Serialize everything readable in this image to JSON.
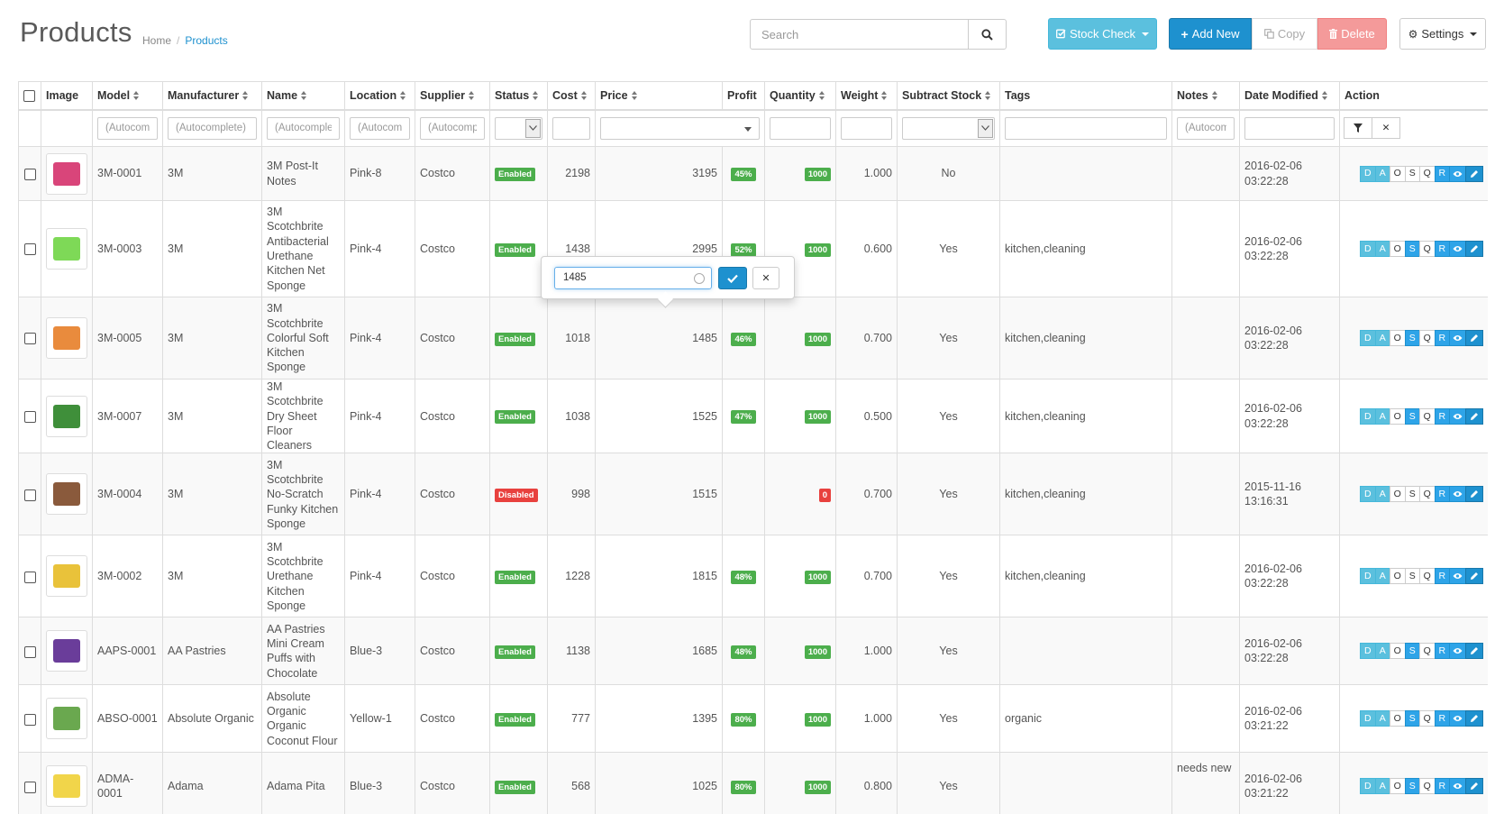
{
  "header": {
    "title": "Products",
    "breadcrumb": [
      "Home",
      "Products"
    ],
    "search_placeholder": "Search",
    "buttons": {
      "stock_check": "Stock Check",
      "add_new": "Add New",
      "copy": "Copy",
      "delete": "Delete",
      "settings": "Settings"
    }
  },
  "colors": {
    "primary": "#1e91cf",
    "info": "#5bc0de",
    "danger": "#f49a9a",
    "enabled": "#4cae4c",
    "disabled": "#e8413e"
  },
  "columns": [
    {
      "label": "Image"
    },
    {
      "label": "Model"
    },
    {
      "label": "Manufacturer"
    },
    {
      "label": "Name"
    },
    {
      "label": "Location"
    },
    {
      "label": "Supplier"
    },
    {
      "label": "Status"
    },
    {
      "label": "Cost"
    },
    {
      "label": "Price"
    },
    {
      "label": "Profit"
    },
    {
      "label": "Quantity"
    },
    {
      "label": "Weight"
    },
    {
      "label": "Subtract Stock"
    },
    {
      "label": "Tags"
    },
    {
      "label": "Notes"
    },
    {
      "label": "Date Modified"
    },
    {
      "label": "Action"
    }
  ],
  "filters": {
    "model": "(Autocomplete)",
    "manufacturer": "(Autocomplete)",
    "name": "(Autocomplete)",
    "location": "(Autocomplete)",
    "supplier": "(Autocomplete)",
    "notes": "(Autocomplete)"
  },
  "action_buttons": [
    "D",
    "A",
    "O",
    "S",
    "Q",
    "R"
  ],
  "popover": {
    "value": "1485"
  },
  "rows": [
    {
      "model": "3M-0001",
      "manufacturer": "3M",
      "name": "3M Post-It Notes",
      "location": "Pink-8",
      "supplier": "Costco",
      "status": "Enabled",
      "cost": "2198",
      "price": "3195",
      "profit": "45%",
      "quantity": "1000",
      "weight": "1.000",
      "subtract": "No",
      "tags": "",
      "notes": "",
      "date": "2016-02-06 03:22:28",
      "img_color": "#d9457a"
    },
    {
      "model": "3M-0003",
      "manufacturer": "3M",
      "name": "3M Scotchbrite Antibacterial Urethane Kitchen Net Sponge",
      "location": "Pink-4",
      "supplier": "Costco",
      "status": "Enabled",
      "cost": "1438",
      "price": "2995",
      "profit": "52%",
      "quantity": "1000",
      "weight": "0.600",
      "subtract": "Yes",
      "tags": "kitchen,cleaning",
      "notes": "",
      "date": "2016-02-06 03:22:28",
      "img_color": "#7ed957"
    },
    {
      "model": "3M-0005",
      "manufacturer": "3M",
      "name": "3M Scotchbrite Colorful Soft Kitchen Sponge",
      "location": "Pink-4",
      "supplier": "Costco",
      "status": "Enabled",
      "cost": "1018",
      "price": "1485",
      "profit": "46%",
      "quantity": "1000",
      "weight": "0.700",
      "subtract": "Yes",
      "tags": "kitchen,cleaning",
      "notes": "",
      "date": "2016-02-06 03:22:28",
      "img_color": "#e98b3d"
    },
    {
      "model": "3M-0007",
      "manufacturer": "3M",
      "name": "3M Scotchbrite Dry Sheet Floor Cleaners",
      "location": "Pink-4",
      "supplier": "Costco",
      "status": "Enabled",
      "cost": "1038",
      "price": "1525",
      "profit": "47%",
      "quantity": "1000",
      "weight": "0.500",
      "subtract": "Yes",
      "tags": "kitchen,cleaning",
      "notes": "",
      "date": "2016-02-06 03:22:28",
      "img_color": "#3f8f3a"
    },
    {
      "model": "3M-0004",
      "manufacturer": "3M",
      "name": "3M Scotchbrite No-Scratch Funky Kitchen Sponge",
      "location": "Pink-4",
      "supplier": "Costco",
      "status": "Disabled",
      "cost": "998",
      "price": "1515",
      "profit": "",
      "quantity": "0",
      "weight": "0.700",
      "subtract": "Yes",
      "tags": "kitchen,cleaning",
      "notes": "",
      "date": "2015-11-16 13:16:31",
      "img_color": "#8a5a3c"
    },
    {
      "model": "3M-0002",
      "manufacturer": "3M",
      "name": "3M Scotchbrite Urethane Kitchen Sponge",
      "location": "Pink-4",
      "supplier": "Costco",
      "status": "Enabled",
      "cost": "1228",
      "price": "1815",
      "profit": "48%",
      "quantity": "1000",
      "weight": "0.700",
      "subtract": "Yes",
      "tags": "kitchen,cleaning",
      "notes": "",
      "date": "2016-02-06 03:22:28",
      "img_color": "#e9c23a"
    },
    {
      "model": "AAPS-0001",
      "manufacturer": "AA Pastries",
      "name": "AA Pastries Mini Cream Puffs with Chocolate",
      "location": "Blue-3",
      "supplier": "Costco",
      "status": "Enabled",
      "cost": "1138",
      "price": "1685",
      "profit": "48%",
      "quantity": "1000",
      "weight": "1.000",
      "subtract": "Yes",
      "tags": "",
      "notes": "",
      "date": "2016-02-06 03:22:28",
      "img_color": "#6a3d9a"
    },
    {
      "model": "ABSO-0001",
      "manufacturer": "Absolute Organic",
      "name": "Absolute Organic Organic Coconut Flour",
      "location": "Yellow-1",
      "supplier": "Costco",
      "status": "Enabled",
      "cost": "777",
      "price": "1395",
      "profit": "80%",
      "quantity": "1000",
      "weight": "1.000",
      "subtract": "Yes",
      "tags": "organic",
      "notes": "",
      "date": "2016-02-06 03:21:22",
      "img_color": "#6aa84f"
    },
    {
      "model": "ADMA-0001",
      "manufacturer": "Adama",
      "name": "Adama Pita",
      "location": "Blue-3",
      "supplier": "Costco",
      "status": "Enabled",
      "cost": "568",
      "price": "1025",
      "profit": "80%",
      "quantity": "1000",
      "weight": "0.800",
      "subtract": "Yes",
      "tags": "",
      "notes": "needs new",
      "date": "2016-02-06 03:21:22",
      "img_color": "#f1d54a"
    }
  ]
}
